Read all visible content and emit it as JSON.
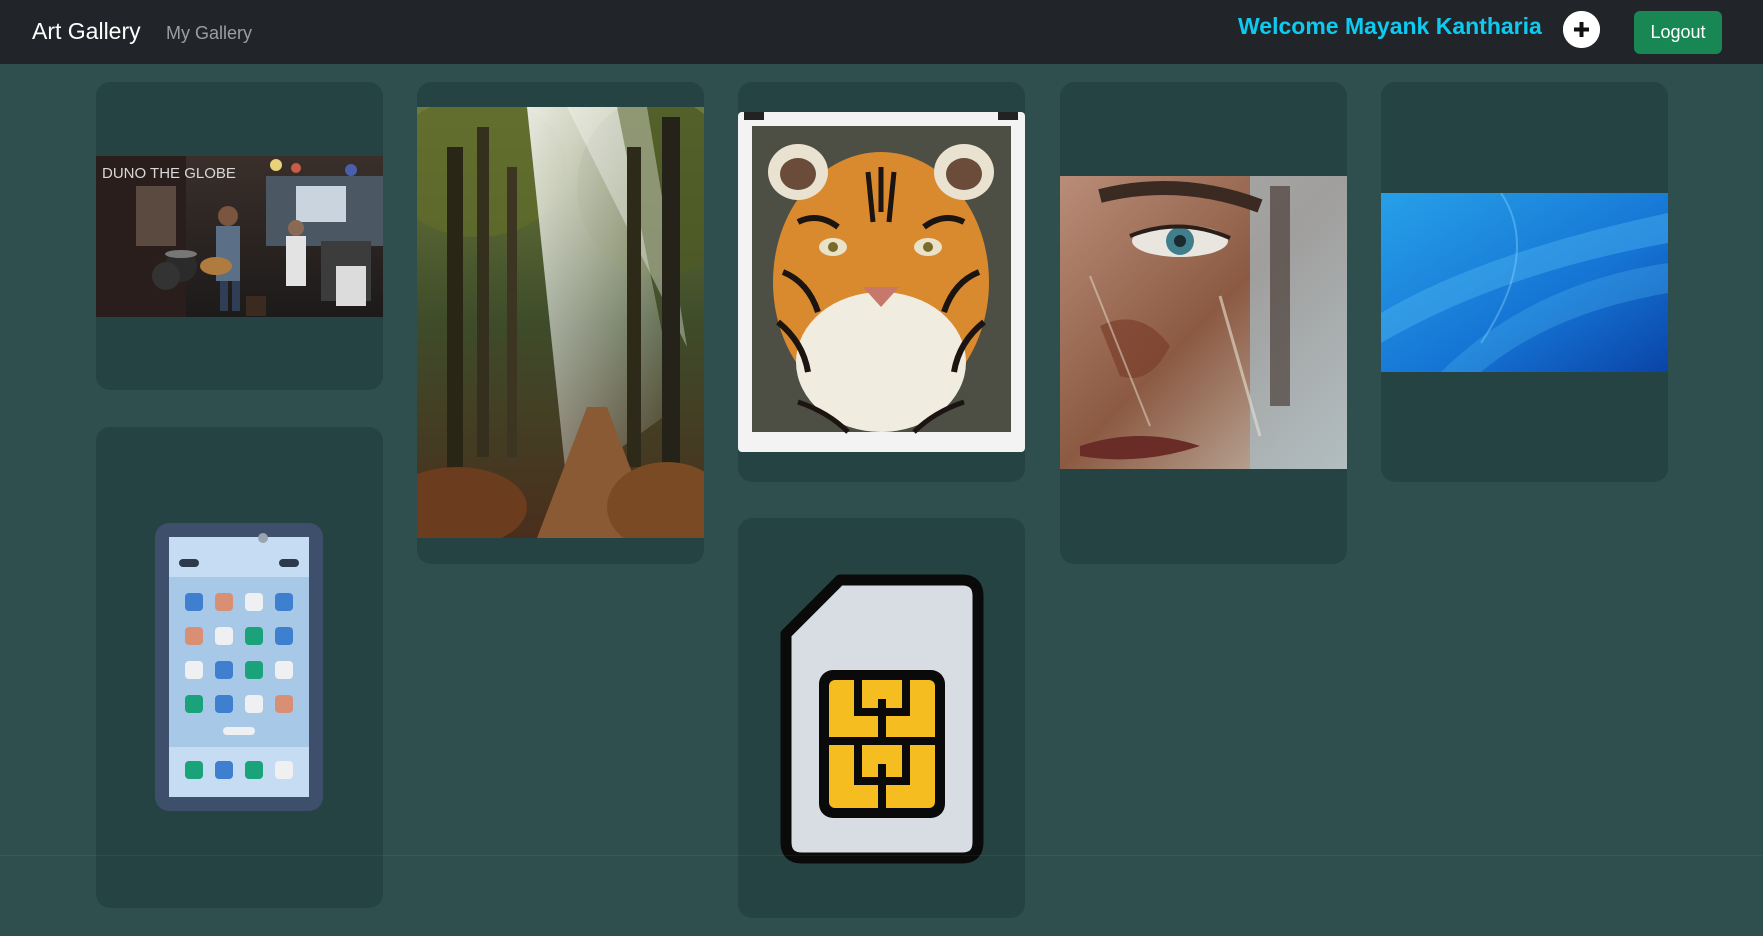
{
  "navbar": {
    "brand": "Art Gallery",
    "my_gallery_link": "My Gallery",
    "welcome_text": "Welcome Mayank Kantharia",
    "add_icon": "plus-circle-icon",
    "logout_label": "Logout"
  },
  "colors": {
    "page_background": "#2f4f4f",
    "navbar_background": "#212529",
    "card_background": "#264343",
    "welcome_text": "#0dcaf0",
    "logout_button": "#198754"
  },
  "gallery": {
    "images": [
      {
        "subject": "band-concert-photo"
      },
      {
        "subject": "sunlit-forest-path-photo"
      },
      {
        "subject": "tiger-portrait-painting"
      },
      {
        "subject": "face-eye-painting"
      },
      {
        "subject": "blue-abstract-wallpaper"
      },
      {
        "subject": "smartphone-illustration"
      },
      {
        "subject": "sim-card-illustration"
      }
    ]
  }
}
